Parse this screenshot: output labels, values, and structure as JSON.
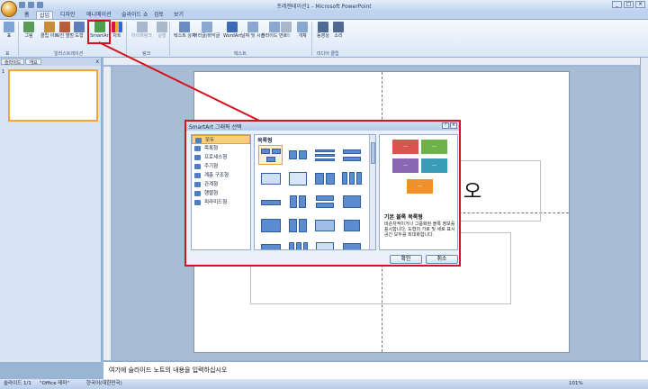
{
  "window": {
    "title": "프레젠테이션1 - Microsoft PowerPoint"
  },
  "tabs": [
    "홈",
    "삽입",
    "디자인",
    "애니메이션",
    "슬라이드 쇼",
    "검토",
    "보기"
  ],
  "active_tab": "삽입",
  "ribbon": {
    "buttons": [
      "표",
      "그림",
      "클립 아트",
      "사진 앨범",
      "도형",
      "SmartArt",
      "차트",
      "하이퍼링크",
      "실행",
      "텍스트 상자",
      "머리글/바닥글",
      "WordArt",
      "날짜 및 시간",
      "슬라이드 번호",
      "기호",
      "개체",
      "동영상",
      "소리"
    ],
    "groups": [
      "표",
      "일러스트레이션",
      "링크",
      "텍스트",
      "미디어 클립"
    ]
  },
  "left_pane": {
    "tabs": [
      "슬라이드",
      "개요"
    ],
    "close": "x",
    "slide_number": "1"
  },
  "slide": {
    "placeholder_char": "오"
  },
  "dialog": {
    "title": "SmartArt 그래픽 선택",
    "categories": [
      "모두",
      "목록형",
      "프로세스형",
      "주기형",
      "계층 구조형",
      "관계형",
      "행렬형",
      "피라미드형"
    ],
    "gallery_heading": "목록형",
    "preview": {
      "title": "기본 블록 목록형",
      "description": "비순차적이거나 그룹화된 블록 정보를 표시합니다. 도형의 가로 및 세로 표시 공간 모두를 최대화합니다.",
      "box_labels": [
        "—",
        "—",
        "—",
        "—",
        "—"
      ],
      "colors": [
        "#d9534f",
        "#6fb24a",
        "#8a67b3",
        "#3c9bb5",
        "#f0902b"
      ]
    },
    "ok": "확인",
    "cancel": "취소"
  },
  "notes": {
    "placeholder": "여기에 슬라이드 노트의 내용을 입력하십시오"
  },
  "status": {
    "slide": "슬라이드 1/1",
    "theme": "\"Office 테마\"",
    "language": "한국어(대한민국)",
    "zoom": "101%"
  }
}
